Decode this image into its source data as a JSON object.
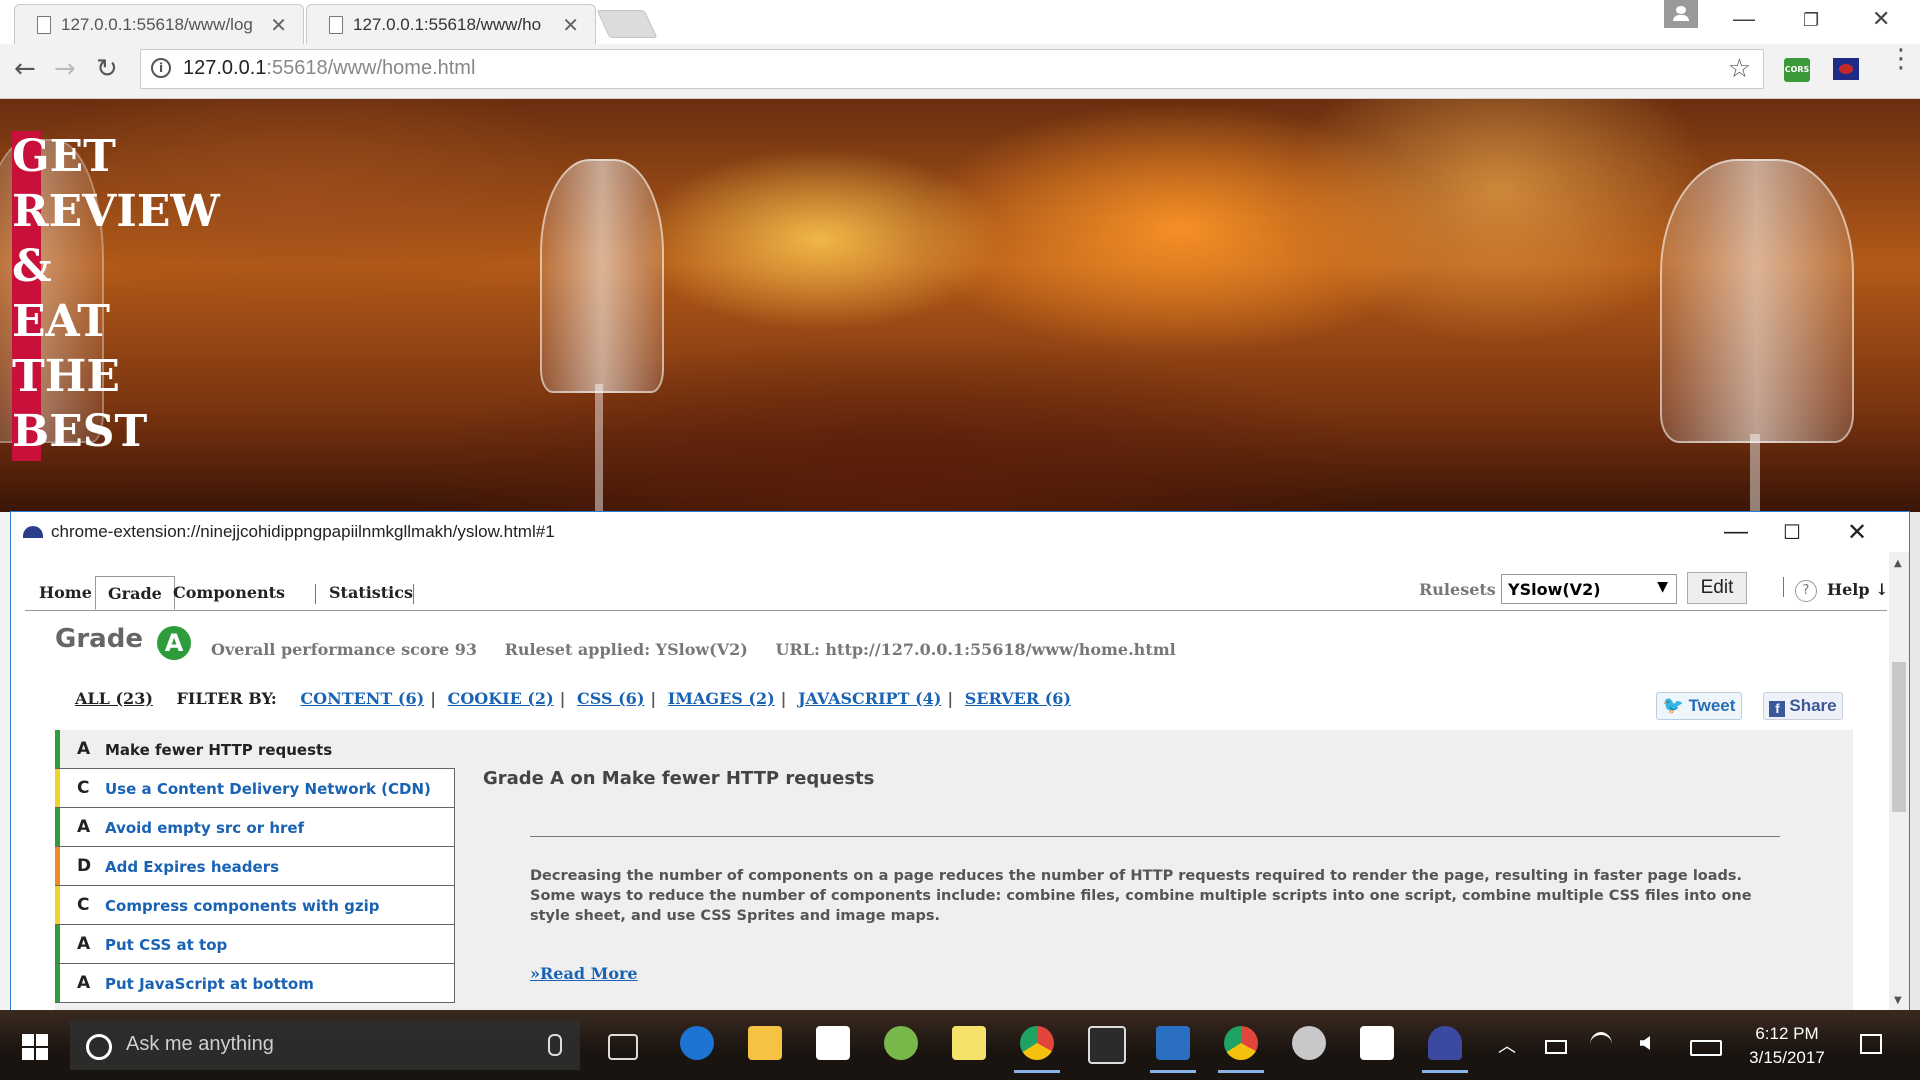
{
  "browser": {
    "tabs": [
      {
        "label": "127.0.0.1:55618/www/log",
        "active": false
      },
      {
        "label": "127.0.0.1:55618/www/ho",
        "active": true
      }
    ],
    "url_host": "127.0.0.1",
    "url_rest": ":55618/www/home.html",
    "extensions": [
      {
        "name": "cors-icon",
        "label": "CORS"
      },
      {
        "name": "yslow-flag-icon"
      }
    ]
  },
  "hero": {
    "title_lines": [
      "GET",
      "REVIEW",
      "&",
      "EAT",
      "THE",
      "BEST"
    ],
    "accent_color": "#c8103a"
  },
  "yslow": {
    "window_title": "chrome-extension://ninejjcohidippngpapiilnmkgllmakh/yslow.html#1",
    "tabs": [
      "Home",
      "Grade",
      "Components",
      "Statistics"
    ],
    "selected_tab": "Grade",
    "rulesets_label": "Rulesets",
    "ruleset_value": "YSlow(V2)",
    "edit_label": "Edit",
    "help_label": "Help ↓",
    "grade_heading": "Grade",
    "grade_letter": "A",
    "overall_score": "Overall performance score 93",
    "ruleset_applied": "Ruleset applied: YSlow(V2)",
    "url_info": "URL: http://127.0.0.1:55618/www/home.html",
    "filter_all": "ALL (23)",
    "filter_by": "FILTER BY:",
    "filters": [
      "CONTENT (6)",
      "COOKIE (2)",
      "CSS (6)",
      "IMAGES (2)",
      "JAVASCRIPT (4)",
      "SERVER (6)"
    ],
    "tweet_label": "Tweet",
    "share_label": "Share",
    "rules": [
      {
        "grade": "A",
        "name": "Make fewer HTTP requests",
        "color": "#2e9c3a",
        "selected": true
      },
      {
        "grade": "C",
        "name": "Use a Content Delivery Network (CDN)",
        "color": "#f2d32a",
        "selected": false
      },
      {
        "grade": "A",
        "name": "Avoid empty src or href",
        "color": "#2e9c3a",
        "selected": false
      },
      {
        "grade": "D",
        "name": "Add Expires headers",
        "color": "#f08a24",
        "selected": false
      },
      {
        "grade": "C",
        "name": "Compress components with gzip",
        "color": "#f2d32a",
        "selected": false
      },
      {
        "grade": "A",
        "name": "Put CSS at top",
        "color": "#2e9c3a",
        "selected": false
      },
      {
        "grade": "A",
        "name": "Put JavaScript at bottom",
        "color": "#2e9c3a",
        "selected": false
      }
    ],
    "detail_title": "Grade A on Make fewer HTTP requests",
    "detail_text": "Decreasing the number of components on a page reduces the number of HTTP requests required to render the page, resulting in faster page loads. Some ways to reduce the number of components include: combine files, combine multiple scripts into one script, combine multiple CSS files into one style sheet, and use CSS Sprites and image maps.",
    "read_more": "»Read More"
  },
  "taskbar": {
    "search_placeholder": "Ask me anything",
    "time": "6:12 PM",
    "date": "3/15/2017",
    "apps": [
      {
        "name": "task-view-icon",
        "color": "#444444"
      },
      {
        "name": "edge-icon",
        "color": "#1e74d2"
      },
      {
        "name": "file-explorer-icon",
        "color": "#f5c242"
      },
      {
        "name": "store-icon",
        "color": "#ffffff"
      },
      {
        "name": "android-studio-icon",
        "color": "#78b84a"
      },
      {
        "name": "sticky-notes-icon",
        "color": "#f4e26a"
      },
      {
        "name": "chrome-icon",
        "color": "#e2453b"
      },
      {
        "name": "terminal-icon",
        "color": "#2b2b2b"
      },
      {
        "name": "brackets-icon",
        "color": "#2b6fc2"
      },
      {
        "name": "chrome-icon-2",
        "color": "#e2453b"
      },
      {
        "name": "snipping-tool-icon",
        "color": "#c8c8c8"
      },
      {
        "name": "photos-icon",
        "color": "#ffffff"
      },
      {
        "name": "yslow-taskbar-icon",
        "color": "#3b4aa0"
      }
    ]
  }
}
